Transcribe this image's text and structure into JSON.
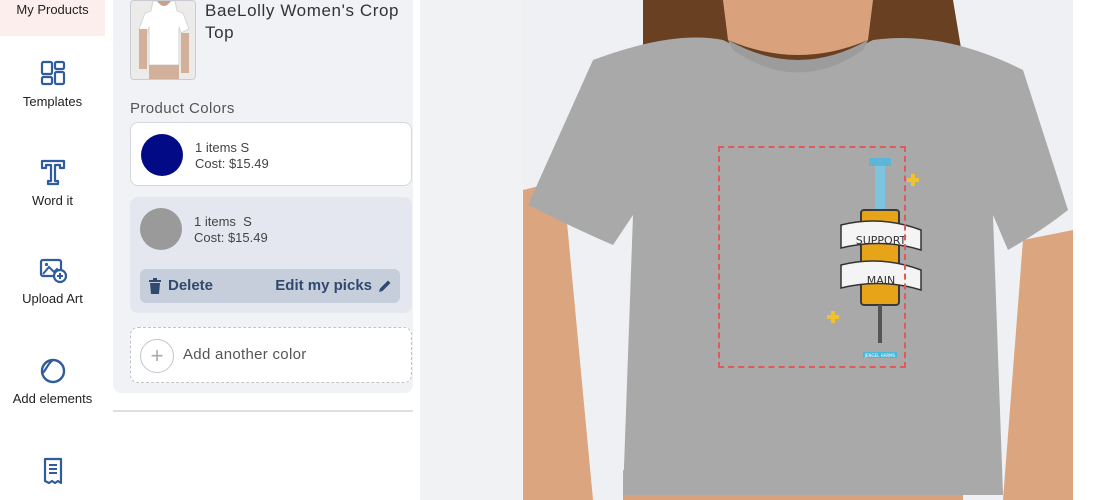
{
  "rail": {
    "items": [
      {
        "label": "My Products",
        "icon": "my-products-icon"
      },
      {
        "label": "Templates",
        "icon": "templates-icon"
      },
      {
        "label": "Word it",
        "icon": "text-icon"
      },
      {
        "label": "Upload Art",
        "icon": "upload-image-icon"
      },
      {
        "label": "Add elements",
        "icon": "elements-icon"
      },
      {
        "label": "",
        "icon": "document-icon"
      }
    ],
    "accent": "#2e5c9e"
  },
  "product": {
    "title": "BaeLolly Women's Crop Top",
    "colors_label": "Product Colors",
    "colors": [
      {
        "swatch": "#020a85",
        "items": "1 items S",
        "cost": "Cost: $15.49"
      },
      {
        "swatch": "#9a9a9a",
        "items": "1 items  S",
        "cost": "Cost: $15.49"
      }
    ],
    "delete_label": "Delete",
    "edit_label": "Edit my picks",
    "add_color_label": "Add another color"
  },
  "design": {
    "banner_top": "SUPPORT",
    "banner_bottom": "MAIN",
    "tag": "JENGEL HARMS"
  },
  "colors": {
    "shirt": "#a9a9a9",
    "print_border": "#e05a5a",
    "action_text": "#2f4a6e"
  }
}
